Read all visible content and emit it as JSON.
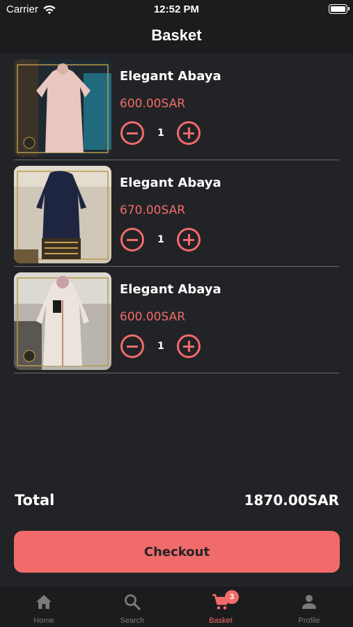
{
  "status_bar": {
    "carrier": "Carrier",
    "time": "12:52 PM"
  },
  "nav": {
    "title": "Basket"
  },
  "items": [
    {
      "name": "Elegant Abaya",
      "price": "600.00SAR",
      "quantity": "1"
    },
    {
      "name": "Elegant Abaya",
      "price": "670.00SAR",
      "quantity": "1"
    },
    {
      "name": "Elegant Abaya",
      "price": "600.00SAR",
      "quantity": "1"
    }
  ],
  "summary": {
    "total_label": "Total",
    "total_value": "1870.00SAR"
  },
  "checkout": {
    "label": "Checkout"
  },
  "tabs": [
    {
      "label": "Home",
      "icon": "home-icon"
    },
    {
      "label": "Search",
      "icon": "search-icon"
    },
    {
      "label": "Basket",
      "icon": "cart-icon",
      "badge": "3",
      "active": true
    },
    {
      "label": "Profile",
      "icon": "person-icon"
    }
  ],
  "colors": {
    "accent": "#f26b6b",
    "background": "#222326",
    "bar": "#1b1c1e",
    "inactive": "#7a7a7d"
  }
}
